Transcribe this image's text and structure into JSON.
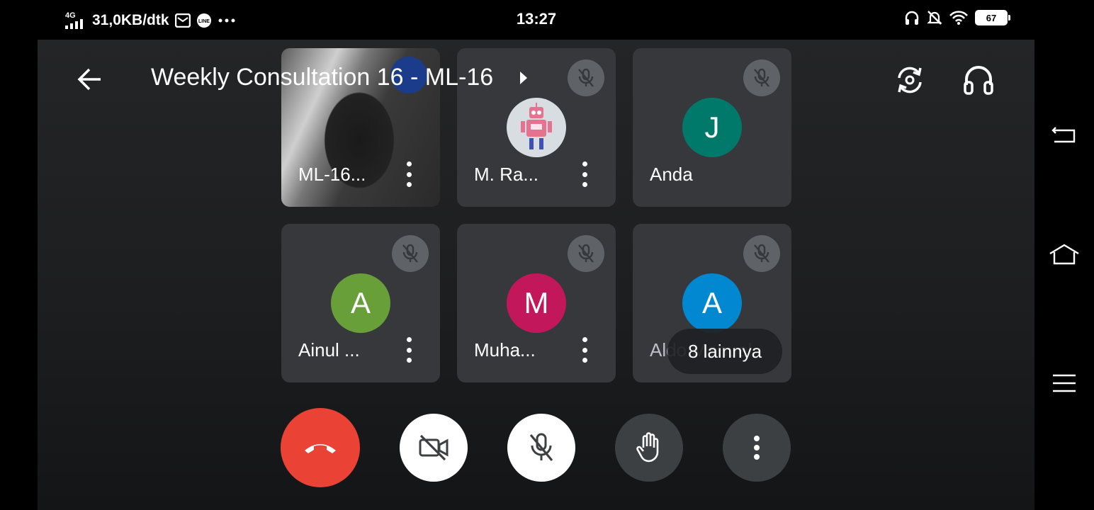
{
  "status_bar": {
    "network": "4G",
    "speed": "31,0KB/dtk",
    "time": "13:27",
    "battery": "67"
  },
  "header": {
    "title": "Weekly Consultation 16 - ML-16"
  },
  "participants": [
    {
      "name": "ML-16...",
      "type": "video"
    },
    {
      "name": "M. Ra...",
      "type": "image",
      "muted": true
    },
    {
      "name": "Anda",
      "initial": "J",
      "color": "#00796b",
      "muted": true
    },
    {
      "name": "Ainul ...",
      "initial": "A",
      "color": "#689f38",
      "muted": true
    },
    {
      "name": "Muha...",
      "initial": "M",
      "color": "#c2185b",
      "muted": true
    },
    {
      "name": "Aldo Manuel",
      "initial": "A",
      "color": "#0288d1",
      "muted": true
    }
  ],
  "more_participants": "8 lainnya",
  "colors": {
    "end_call": "#ea4335",
    "control_white": "#ffffff",
    "control_dark": "#3c4043"
  },
  "icons": [
    "back-arrow-icon",
    "switch-camera-icon",
    "headphones-icon",
    "mic-off-icon",
    "more-vert-icon",
    "end-call-icon",
    "camera-off-icon",
    "raise-hand-icon",
    "nav-back-icon",
    "nav-home-icon",
    "nav-menu-icon"
  ]
}
